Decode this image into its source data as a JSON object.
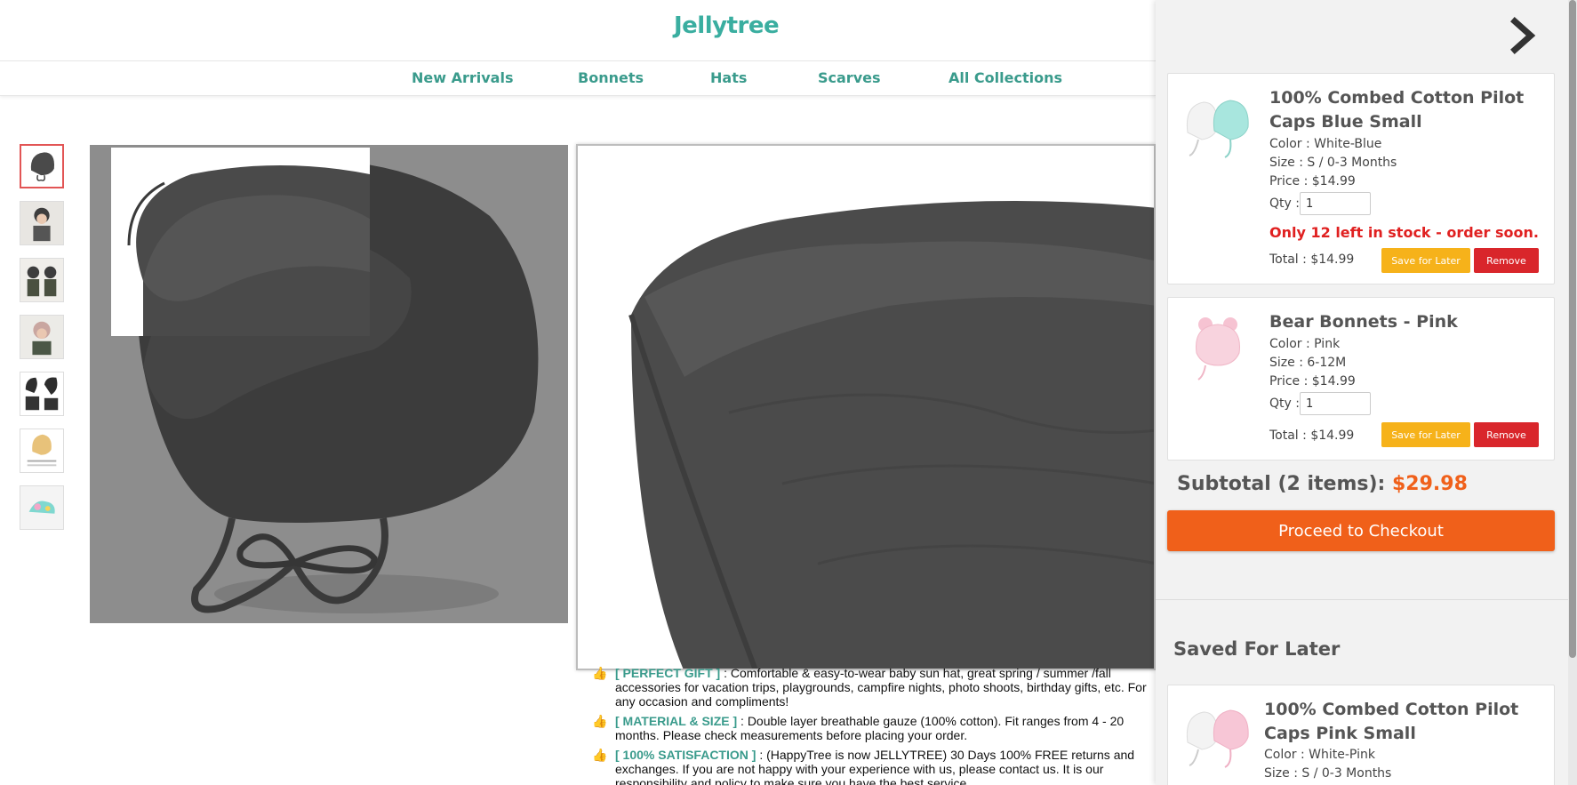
{
  "header": {
    "logo": "Jellytree"
  },
  "nav": {
    "items": [
      {
        "label": "New Arrivals"
      },
      {
        "label": "Bonnets"
      },
      {
        "label": "Hats"
      },
      {
        "label": "Scarves"
      },
      {
        "label": "All Collections"
      }
    ]
  },
  "product": {
    "bullets": [
      {
        "tag": "[ PERFECT GIFT ]",
        "text": " : Comfortable & easy-to-wear baby sun hat, great spring / summer /fall accessories for vacation trips, playgrounds, campfire nights, photo shoots, birthday gifts, etc. For any occasion and compliments!"
      },
      {
        "tag": "[ MATERIAL & SIZE ]",
        "text": " : Double layer breathable gauze (100% cotton). Fit ranges from 4 - 20 months. Please check measurements before placing your order."
      },
      {
        "tag": "[ 100% SATISFACTION ]",
        "text": " : (HappyTree is now JELLYTREE) 30 Days 100% FREE returns and exchanges. If you are not happy with your experience with us, please contact us. It is our responsibility and policy to make sure you have the best service."
      }
    ]
  },
  "cart": {
    "items": [
      {
        "title": "100% Combed Cotton Pilot Caps Blue Small",
        "color": "Color : White-Blue",
        "size": "Size : S / 0-3 Months",
        "price": "Price : $14.99",
        "qty_label": "Qty :",
        "qty": "1",
        "stock": "Only 12 left in stock - order soon.",
        "total": "Total : $14.99",
        "save_label": "Save for Later",
        "remove_label": "Remove"
      },
      {
        "title": "Bear Bonnets - Pink",
        "color": "Color : Pink",
        "size": "Size : 6-12M",
        "price": "Price : $14.99",
        "qty_label": "Qty :",
        "qty": "1",
        "total": "Total : $14.99",
        "save_label": "Save for Later",
        "remove_label": "Remove"
      }
    ],
    "subtotal_label": "Subtotal (2 items): ",
    "subtotal_amount": "$29.98",
    "checkout_label": "Proceed to Checkout",
    "saved_heading": "Saved For Later",
    "saved_items": [
      {
        "title": "100% Combed Cotton Pilot Caps Pink Small",
        "color": "Color : White-Pink",
        "size": "Size : S / 0-3 Months"
      }
    ]
  },
  "colors": {
    "brand_teal": "#3aaea0",
    "checkout_orange": "#f0601a",
    "save_yellow": "#f6b21a",
    "remove_red": "#d9262b",
    "stock_red": "#e02020"
  }
}
